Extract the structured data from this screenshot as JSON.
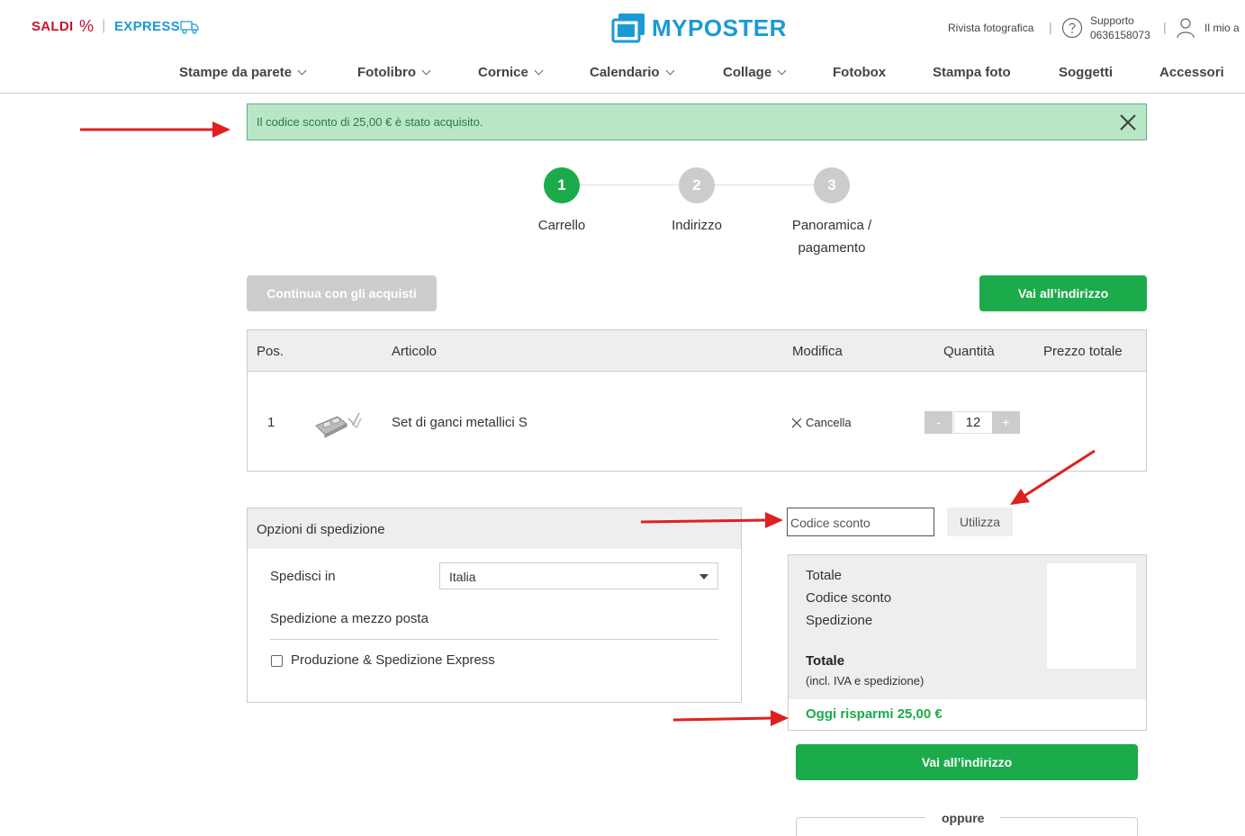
{
  "header": {
    "saldi": "SALDI",
    "percent_symbol": "%",
    "separator": "|",
    "express": "EXPRESS",
    "logo_text": "MYPOSTER",
    "rivista": "Rivista fotografica",
    "support_label": "Supporto",
    "support_phone": "0636158073",
    "account": "Il mio a"
  },
  "nav": {
    "items": [
      {
        "label": "Stampe da parete",
        "dropdown": true
      },
      {
        "label": "Fotolibro",
        "dropdown": true
      },
      {
        "label": "Cornice",
        "dropdown": true
      },
      {
        "label": "Calendario",
        "dropdown": true
      },
      {
        "label": "Collage",
        "dropdown": true
      },
      {
        "label": "Fotobox",
        "dropdown": false
      },
      {
        "label": "Stampa foto",
        "dropdown": false
      },
      {
        "label": "Soggetti",
        "dropdown": false
      },
      {
        "label": "Accessori",
        "dropdown": false
      }
    ]
  },
  "alert": {
    "message": "Il codice sconto di 25,00 € è stato acquisito."
  },
  "steps": [
    {
      "number": "1",
      "label_line1": "Carrello",
      "label_line2": "",
      "active": true
    },
    {
      "number": "2",
      "label_line1": "Indirizzo",
      "label_line2": "",
      "active": false
    },
    {
      "number": "3",
      "label_line1": "Panoramica /",
      "label_line2": "pagamento",
      "active": false
    }
  ],
  "buttons": {
    "continue_shopping": "Continua con gli acquisti",
    "go_to_address": "Vai all’indirizzo"
  },
  "cart": {
    "columns": {
      "pos": "Pos.",
      "article": "Articolo",
      "edit": "Modifica",
      "quantity": "Quantità",
      "total_price": "Prezzo totale"
    },
    "items": [
      {
        "pos": "1",
        "name": "Set di ganci metallici S",
        "cancel_label": "Cancella",
        "quantity": "12",
        "minus": "-",
        "plus": "+"
      }
    ]
  },
  "shipping": {
    "title": "Opzioni di spedizione",
    "ship_to_label": "Spedisci in",
    "ship_to_value": "Italia",
    "method": "Spedizione a mezzo posta",
    "express_option": "Produzione & Spedizione Express",
    "express_checked": false
  },
  "coupon": {
    "placeholder": "Codice sconto",
    "apply_label": "Utilizza"
  },
  "summary": {
    "total_label": "Totale",
    "coupon_label": "Codice sconto",
    "shipping_label": "Spedizione",
    "grand_total_label": "Totale",
    "grand_total_note": "(incl. IVA e spedizione)",
    "savings": "Oggi risparmi 25,00 €"
  },
  "oppure": "oppure",
  "colors": {
    "brand_blue": "#1a9ad6",
    "sale_red": "#c8102e",
    "primary_green": "#1bab4a",
    "alert_bg": "#b9e6c7",
    "annotation_red": "#e02020"
  }
}
